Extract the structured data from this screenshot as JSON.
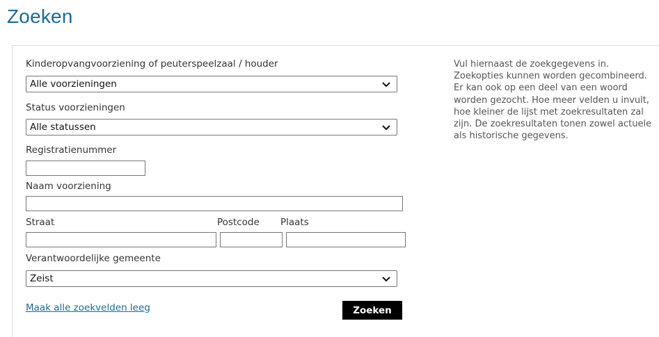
{
  "page": {
    "title": "Zoeken"
  },
  "form": {
    "facility": {
      "label": "Kinderopvangvoorziening of peuterspeelzaal / houder",
      "value": "Alle voorzieningen"
    },
    "status": {
      "label": "Status voorzieningen",
      "value": "Alle statussen"
    },
    "registration": {
      "label": "Registratienummer",
      "value": ""
    },
    "name": {
      "label": "Naam voorziening",
      "value": ""
    },
    "street": {
      "label": "Straat",
      "value": ""
    },
    "postcode": {
      "label": "Postcode",
      "value": ""
    },
    "city": {
      "label": "Plaats",
      "value": ""
    },
    "municipality": {
      "label": "Verantwoordelijke gemeente",
      "value": "Zeist"
    },
    "clear_link": "Maak alle zoekvelden leeg",
    "submit_label": "Zoeken"
  },
  "help_text": "Vul hiernaast de zoekgegevens in. Zoekopties kunnen worden gecombineerd. Er kan ook op een deel van een woord worden gezocht. Hoe meer velden u invult, hoe kleiner de lijst met zoekresultaten zal zijn. De zoekresultaten tonen zowel actuele als historische gegevens.",
  "colors": {
    "title": "#1b6a93",
    "link": "#1b6a93",
    "button_bg": "#000000",
    "button_text": "#ffffff",
    "border": "#767676"
  },
  "icons": {
    "dropdown": "chevron-down-icon"
  }
}
